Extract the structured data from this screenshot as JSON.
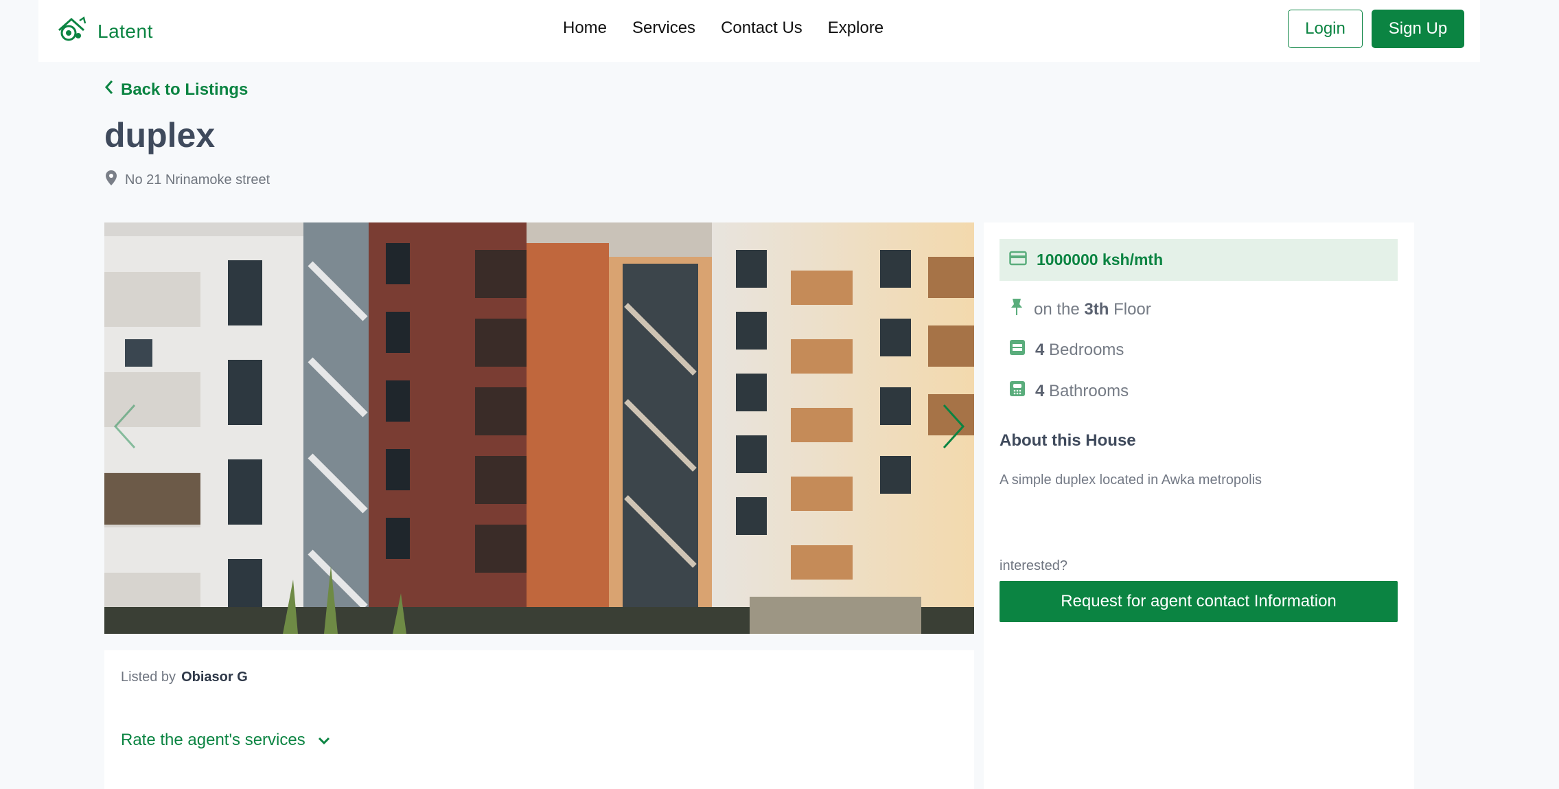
{
  "brand": {
    "name": "Latent",
    "accent": "#0b8442"
  },
  "nav": {
    "links": [
      "Home",
      "Services",
      "Contact Us",
      "Explore"
    ],
    "login": "Login",
    "signup": "Sign Up"
  },
  "listing": {
    "back_label": "Back to Listings",
    "title": "duplex",
    "address": "No 21 Nrinamoke street",
    "price": "1000000 ksh/mth",
    "floor_prefix": "on the",
    "floor_value": "3th",
    "floor_suffix": "Floor",
    "bedrooms_count": "4",
    "bedrooms_label": "Bedrooms",
    "bathrooms_count": "4",
    "bathrooms_label": "Bathrooms",
    "about_title": "About this House",
    "about_text": "A simple duplex located in Awka metropolis",
    "interested": "interested?",
    "cta": "Request for agent contact Information"
  },
  "agent": {
    "listed_by_label": "Listed by",
    "name": "Obiasor G",
    "rate_label": "Rate the agent's services"
  },
  "icons": {
    "logo": "house-logo-icon",
    "back": "chevron-left-icon",
    "location": "map-pin-icon",
    "price": "credit-card-icon",
    "floor": "pushpin-icon",
    "bedrooms": "bed-icon",
    "bathrooms": "bath-icon",
    "rate": "chevron-down-icon",
    "carousel_prev": "chevron-left-icon",
    "carousel_next": "chevron-right-icon"
  }
}
